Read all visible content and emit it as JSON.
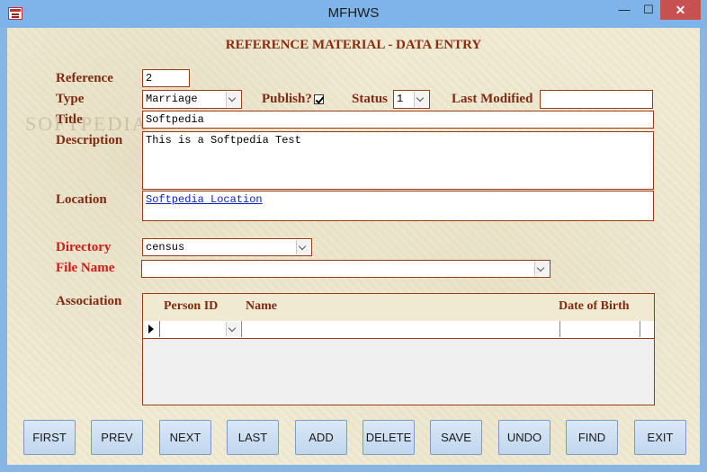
{
  "window": {
    "title": "MFHWS",
    "min_glyph": "—",
    "max_glyph": "☐",
    "close_glyph": "✕"
  },
  "form": {
    "heading": "REFERENCE MATERIAL - DATA ENTRY",
    "watermark": "SOFTPEDIA",
    "labels": {
      "reference": "Reference",
      "type": "Type",
      "publish": "Publish?",
      "status": "Status",
      "last_modified": "Last Modified",
      "title": "Title",
      "description": "Description",
      "location": "Location",
      "directory": "Directory",
      "file_name": "File Name",
      "association": "Association"
    },
    "values": {
      "reference": "2",
      "type": "Marriage",
      "publish_checked": true,
      "status": "1",
      "last_modified": "",
      "title": "Softpedia",
      "description": "This is a Softpedia Test",
      "location": "Softpedia Location",
      "directory": "census",
      "file_name": ""
    }
  },
  "association": {
    "columns": [
      "Person ID",
      "Name",
      "Date of Birth"
    ],
    "rows": [
      {
        "person_id": "",
        "name": "",
        "date_of_birth": ""
      }
    ]
  },
  "buttons": [
    "FIRST",
    "PREV",
    "NEXT",
    "LAST",
    "ADD",
    "DELETE",
    "SAVE",
    "UNDO",
    "FIND",
    "EXIT"
  ],
  "colors": {
    "label": "#7f2a13",
    "label_red": "#d2191a",
    "title_bar": "#7eb4ea",
    "close": "#c75050",
    "link": "#0a22c8"
  }
}
